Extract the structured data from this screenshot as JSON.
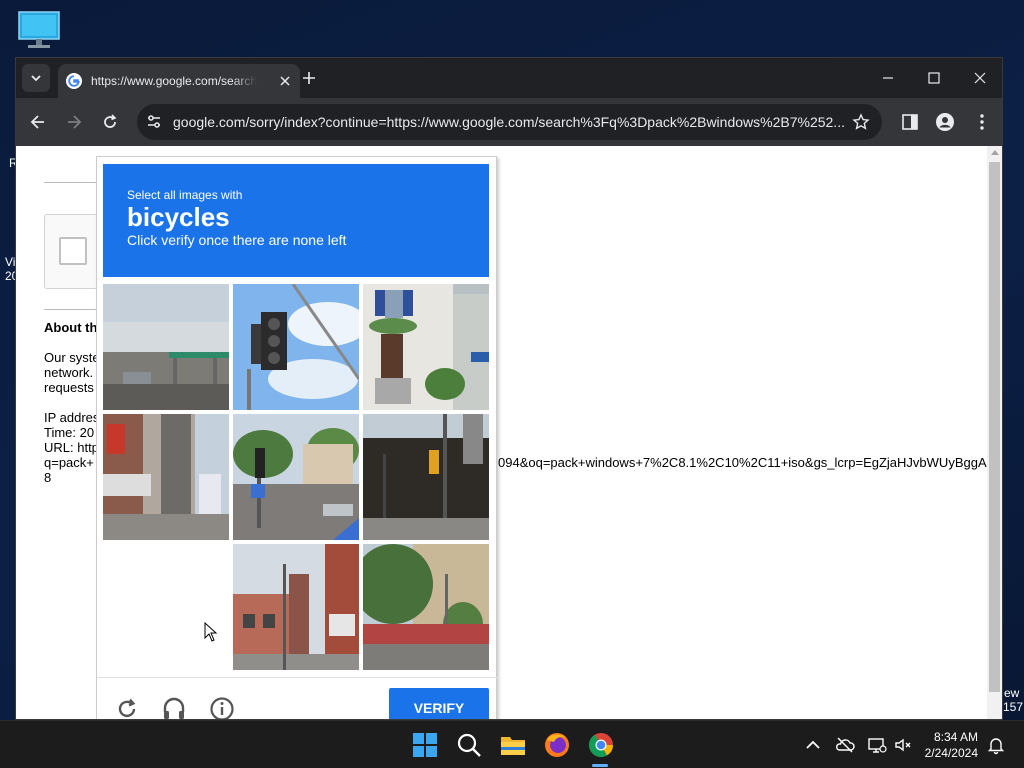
{
  "desktop": {
    "side_left_1": "R",
    "side_left_2": "Vi",
    "side_left_3": "20",
    "side_right_1": "ew",
    "side_right_2": "157"
  },
  "browser": {
    "tab_title": "https://www.google.com/search?q=pack+windows",
    "url": "google.com/sorry/index?continue=https://www.google.com/search%3Fq%3Dpack%2Bwindows%2B7%252..."
  },
  "page": {
    "heading": "About th",
    "para_1": "Our syste",
    "para_2": "network.",
    "para_3": "requests",
    "ip_line": "IP addres",
    "time_line": "Time: 20",
    "url_line": "URL: http",
    "q_line": "q=pack+",
    "num_line": "8",
    "tail": "094&oq=pack+windows+7%2C8.1%2C10%2C11+iso&gs_lcrp=EgZjaHJvbWUyBggA"
  },
  "captcha": {
    "select_text": "Select all images with",
    "target": "bicycles",
    "instruction": "Click verify once there are none left",
    "verify_label": "VERIFY"
  },
  "taskbar": {
    "time": "8:34 AM",
    "date": "2/24/2024"
  }
}
